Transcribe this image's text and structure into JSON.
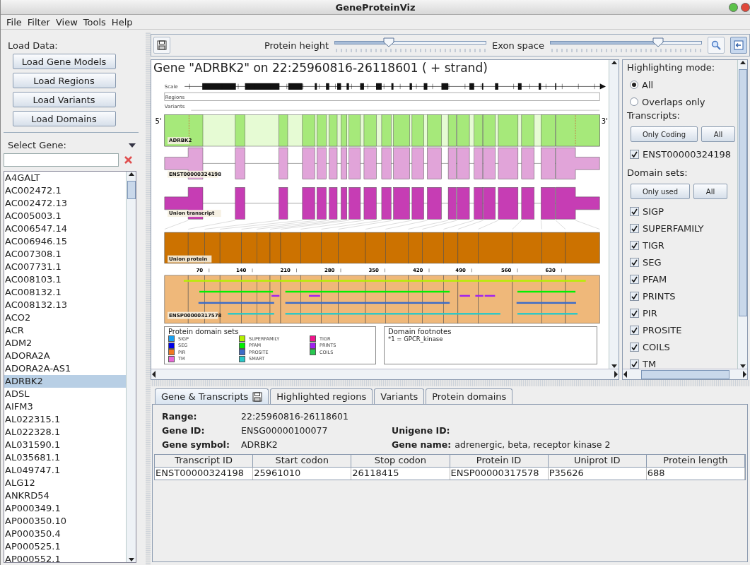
{
  "window": {
    "title": "GeneProteinViz"
  },
  "menu": [
    "File",
    "Filter",
    "View",
    "Tools",
    "Help"
  ],
  "left_panel": {
    "load_label": "Load Data:",
    "load_buttons": [
      "Load Gene Models",
      "Load Regions",
      "Load Variants",
      "Load Domains"
    ],
    "select_label": "Select Gene:",
    "genes": [
      {
        "name": "A4GALT",
        "selected": false
      },
      {
        "name": "AC002472.1",
        "selected": false
      },
      {
        "name": "AC002472.13",
        "selected": false
      },
      {
        "name": "AC005003.1",
        "selected": false
      },
      {
        "name": "AC006547.14",
        "selected": false
      },
      {
        "name": "AC006946.15",
        "selected": false
      },
      {
        "name": "AC007308.1",
        "selected": false
      },
      {
        "name": "AC007731.1",
        "selected": false
      },
      {
        "name": "AC008103.1",
        "selected": false
      },
      {
        "name": "AC008132.1",
        "selected": false
      },
      {
        "name": "AC008132.13",
        "selected": false
      },
      {
        "name": "ACO2",
        "selected": false
      },
      {
        "name": "ACR",
        "selected": false
      },
      {
        "name": "ADM2",
        "selected": false
      },
      {
        "name": "ADORA2A",
        "selected": false
      },
      {
        "name": "ADORA2A-AS1",
        "selected": false
      },
      {
        "name": "ADRBK2",
        "selected": true
      },
      {
        "name": "ADSL",
        "selected": false
      },
      {
        "name": "AIFM3",
        "selected": false
      },
      {
        "name": "AL022315.1",
        "selected": false
      },
      {
        "name": "AL022328.1",
        "selected": false
      },
      {
        "name": "AL031590.1",
        "selected": false
      },
      {
        "name": "AL035681.1",
        "selected": false
      },
      {
        "name": "AL049747.1",
        "selected": false
      },
      {
        "name": "ALG12",
        "selected": false
      },
      {
        "name": "ANKRD54",
        "selected": false
      },
      {
        "name": "AP000349.1",
        "selected": false
      },
      {
        "name": "AP000350.10",
        "selected": false
      },
      {
        "name": "AP000350.4",
        "selected": false
      },
      {
        "name": "AP000525.1",
        "selected": false
      },
      {
        "name": "AP000552.1",
        "selected": false
      }
    ]
  },
  "toolbar": {
    "sliders": [
      {
        "label": "Protein height",
        "level": 0.36
      },
      {
        "label": "Exon space",
        "level": 0.71
      }
    ]
  },
  "diagram": {
    "title": "Gene \"ADRBK2\" on 22:25960816-26118601 ( + strand)",
    "scale_label": "Scale",
    "regions_label": "Regions",
    "variants_label": "Variants",
    "five_prime": "5'",
    "three_prime": "3'",
    "gene_label": "ADRBK2",
    "transcript_label": "ENST00000324198",
    "union_transcript_label": "Union transcript",
    "union_protein_label": "Union protein",
    "protein_ticks": [
      "70",
      "140",
      "210",
      "280",
      "350",
      "420",
      "490",
      "560",
      "630"
    ],
    "protein_label": "ENSP00000317578",
    "legend": {
      "title": "Protein domain sets",
      "items": [
        {
          "name": "SIGP",
          "color": "#1aa0f0"
        },
        {
          "name": "SUPERFAMILY",
          "color": "#b4f000"
        },
        {
          "name": "TIGR",
          "color": "#f0148c"
        },
        {
          "name": "SEG",
          "color": "#0000e6"
        },
        {
          "name": "PFAM",
          "color": "#00f000"
        },
        {
          "name": "PRINTS",
          "color": "#a020f0"
        },
        {
          "name": "PIR",
          "color": "#f07820"
        },
        {
          "name": "PROSITE",
          "color": "#3c6cc8"
        },
        {
          "name": "COILS",
          "color": "#28c850"
        },
        {
          "name": "TM",
          "color": "#e868d8"
        },
        {
          "name": "SMART",
          "color": "#28c8c8"
        }
      ]
    },
    "footnotes": {
      "title": "Domain footnotes",
      "lines": [
        "*1 = GPCR_kinase"
      ]
    }
  },
  "highlight_panel": {
    "mode_label": "Highlighting mode:",
    "modes": [
      {
        "label": "All",
        "selected": true
      },
      {
        "label": "Overlaps only",
        "selected": false
      }
    ],
    "transcripts_label": "Transcripts:",
    "transcript_buttons": [
      "Only Coding",
      "All"
    ],
    "transcripts": [
      {
        "label": "ENST00000324198",
        "checked": true
      }
    ],
    "domain_label": "Domain sets:",
    "domain_buttons": [
      "Only used",
      "All"
    ],
    "domain_sets": [
      {
        "label": "SIGP",
        "checked": true
      },
      {
        "label": "SUPERFAMILY",
        "checked": true
      },
      {
        "label": "TIGR",
        "checked": true
      },
      {
        "label": "SEG",
        "checked": true
      },
      {
        "label": "PFAM",
        "checked": true
      },
      {
        "label": "PRINTS",
        "checked": true
      },
      {
        "label": "PIR",
        "checked": true
      },
      {
        "label": "PROSITE",
        "checked": true
      },
      {
        "label": "COILS",
        "checked": true
      },
      {
        "label": "TM",
        "checked": true
      }
    ]
  },
  "details": {
    "tabs": [
      {
        "label": "Gene & Transcripts",
        "selected": true,
        "save_icon": true
      },
      {
        "label": "Highlighted regions",
        "selected": false
      },
      {
        "label": "Variants",
        "selected": false
      },
      {
        "label": "Protein domains",
        "selected": false
      }
    ],
    "field_rows": [
      [
        {
          "label": "Range:",
          "value": "22:25960816-26118601"
        }
      ],
      [
        {
          "label": "Gene ID:",
          "value": "ENSG00000100077"
        },
        {
          "label": "Unigene ID:"
        }
      ],
      [
        {
          "label": "Gene symbol:",
          "value": "ADRBK2"
        },
        {
          "label": "Gene name:",
          "value": "adrenergic, beta, receptor kinase 2"
        }
      ]
    ],
    "table": {
      "columns": [
        "Transcript ID",
        "Start codon",
        "Stop codon",
        "Protein ID",
        "Uniprot ID",
        "Protein length"
      ],
      "rows": [
        [
          "ENST00000324198",
          "25961010",
          "26118415",
          "ENSP00000317578",
          "P35626",
          "688"
        ]
      ]
    }
  }
}
